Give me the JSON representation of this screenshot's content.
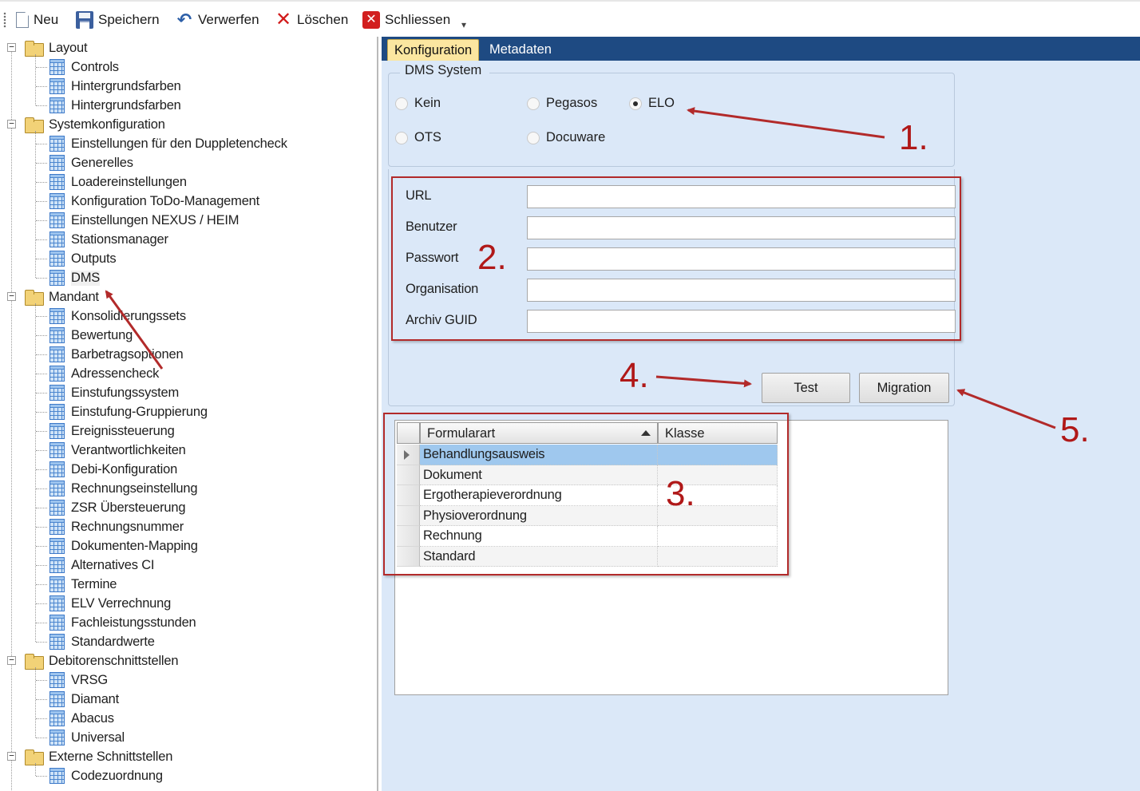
{
  "toolbar": {
    "new_label": "Neu",
    "save_label": "Speichern",
    "discard_label": "Verwerfen",
    "delete_label": "Löschen",
    "close_label": "Schliessen"
  },
  "tree": {
    "groups": [
      {
        "label": "Layout",
        "expanded": true,
        "items": [
          "Controls",
          "Hintergrundsfarben",
          "Hintergrundsfarben"
        ]
      },
      {
        "label": "Systemkonfiguration",
        "expanded": true,
        "items": [
          "Einstellungen für den Duppletencheck",
          "Generelles",
          "Loadereinstellungen",
          "Konfiguration ToDo-Management",
          "Einstellungen NEXUS / HEIM",
          "Stationsmanager",
          "Outputs",
          "DMS"
        ]
      },
      {
        "label": "Mandant",
        "expanded": true,
        "items": [
          "Konsolidierungssets",
          "Bewertung",
          "Barbetragsoptionen",
          "Adressencheck",
          "Einstufungssystem",
          "Einstufung-Gruppierung",
          "Ereignissteuerung",
          "Verantwortlichkeiten",
          "Debi-Konfiguration",
          "Rechnungseinstellung",
          "ZSR Übersteuerung",
          "Rechnungsnummer",
          "Dokumenten-Mapping",
          "Alternatives CI",
          "Termine",
          "ELV Verrechnung",
          "Fachleistungsstunden",
          "Standardwerte"
        ]
      },
      {
        "label": "Debitorenschnittstellen",
        "expanded": true,
        "items": [
          "VRSG",
          "Diamant",
          "Abacus",
          "Universal"
        ]
      },
      {
        "label": "Externe Schnittstellen",
        "expanded": true,
        "items": [
          "Codezuordnung"
        ]
      }
    ],
    "selected": "DMS"
  },
  "tabs": [
    {
      "label": "Konfiguration",
      "active": true
    },
    {
      "label": "Metadaten",
      "active": false
    }
  ],
  "dms": {
    "legend": "DMS System",
    "options": [
      "Kein",
      "Pegasos",
      "ELO",
      "OTS",
      "Docuware"
    ],
    "selected": "ELO"
  },
  "fields": [
    {
      "label": "URL",
      "value": ""
    },
    {
      "label": "Benutzer",
      "value": ""
    },
    {
      "label": "Passwort",
      "value": ""
    },
    {
      "label": "Organisation",
      "value": ""
    },
    {
      "label": "Archiv GUID",
      "value": ""
    }
  ],
  "buttons": {
    "test": "Test",
    "migration": "Migration"
  },
  "grid": {
    "columns": [
      "Formularart",
      "Klasse"
    ],
    "rows": [
      {
        "formularart": "Behandlungsausweis",
        "klasse": ""
      },
      {
        "formularart": "Dokument",
        "klasse": ""
      },
      {
        "formularart": "Ergotherapieverordnung",
        "klasse": ""
      },
      {
        "formularart": "Physioverordnung",
        "klasse": ""
      },
      {
        "formularart": "Rechnung",
        "klasse": ""
      },
      {
        "formularart": "Standard",
        "klasse": ""
      }
    ],
    "selected_row": 0
  },
  "annotations": [
    "1.",
    "2.",
    "3.",
    "4.",
    "5."
  ],
  "colors": {
    "accent_tab": "#fbe6a0",
    "tab_bar": "#1e4a82",
    "panel_bg": "#dbe8f8",
    "annotation": "#b01818",
    "selected_row": "#9fc8ee"
  }
}
